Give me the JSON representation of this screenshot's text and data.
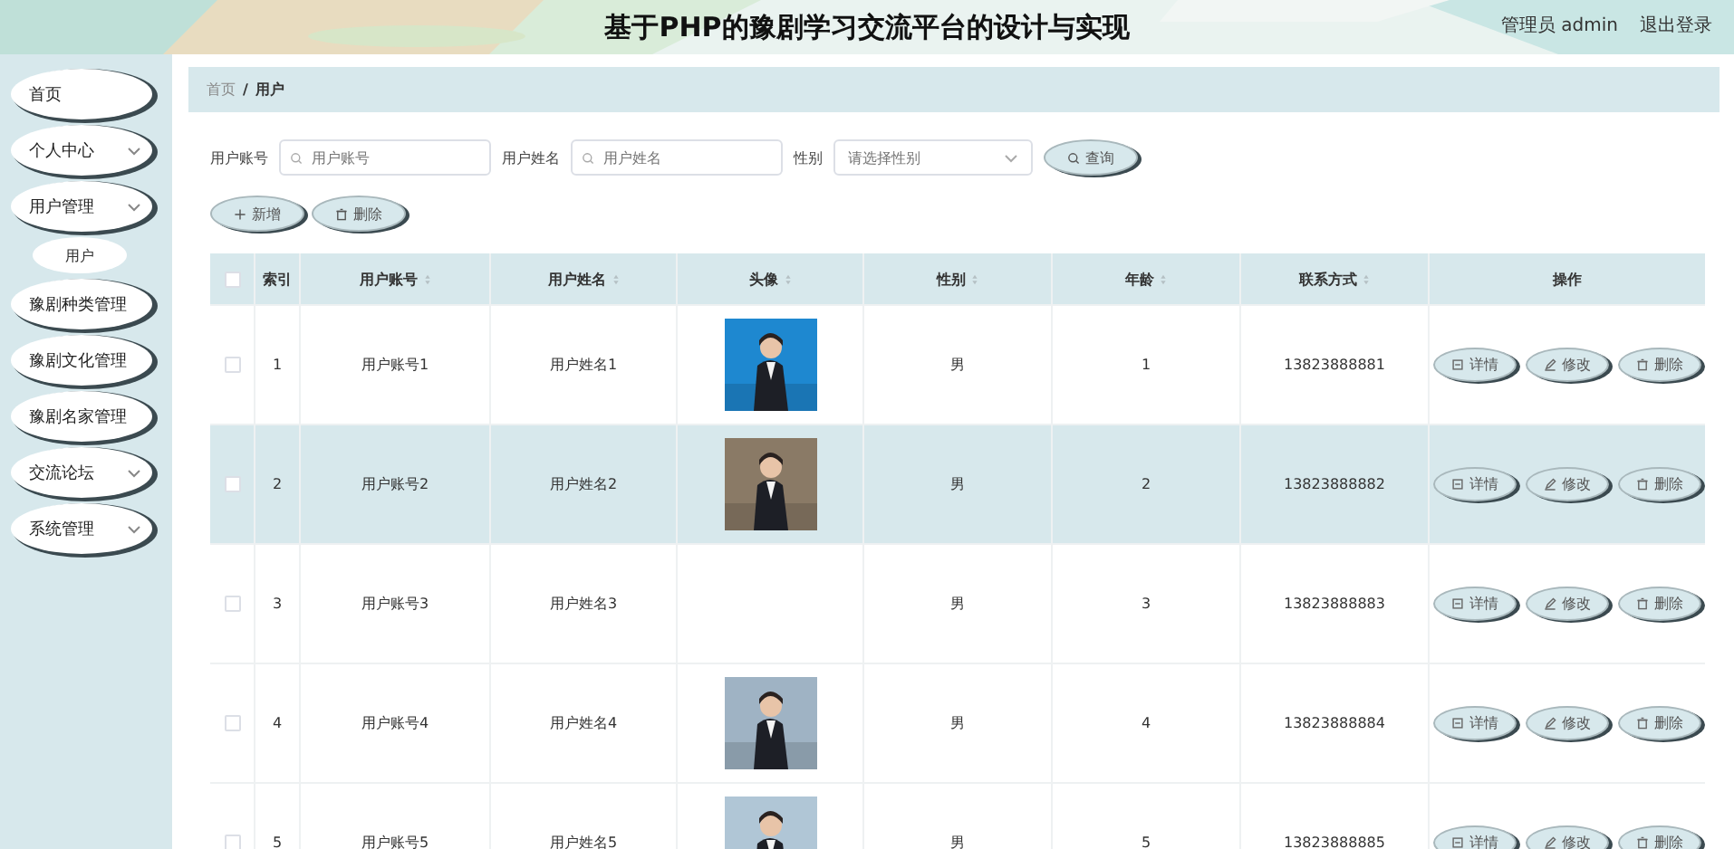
{
  "header": {
    "title": "基于PHP的豫剧学习交流平台的设计与实现",
    "user": "管理员 admin",
    "logout": "退出登录"
  },
  "sidebar": {
    "items": [
      {
        "label": "首页",
        "expandable": false
      },
      {
        "label": "个人中心",
        "expandable": true
      },
      {
        "label": "用户管理",
        "expandable": true,
        "children": [
          {
            "label": "用户",
            "selected": true
          }
        ]
      },
      {
        "label": "豫剧种类管理",
        "expandable": false
      },
      {
        "label": "豫剧文化管理",
        "expandable": false
      },
      {
        "label": "豫剧名家管理",
        "expandable": false
      },
      {
        "label": "交流论坛",
        "expandable": true
      },
      {
        "label": "系统管理",
        "expandable": true
      }
    ]
  },
  "breadcrumb": {
    "items": [
      "首页",
      "用户"
    ],
    "separator": "/"
  },
  "search": {
    "fields": [
      {
        "kind": "text",
        "label": "用户账号",
        "placeholder": "用户账号"
      },
      {
        "kind": "text",
        "label": "用户姓名",
        "placeholder": "用户姓名"
      },
      {
        "kind": "select",
        "label": "性别",
        "placeholder": "请选择性别"
      }
    ],
    "button": "查询"
  },
  "actions": [
    "新增",
    "删除"
  ],
  "table": {
    "select_all_checked": false,
    "columns": [
      {
        "label": "索引",
        "sortable": false
      },
      {
        "label": "用户账号",
        "sortable": true
      },
      {
        "label": "用户姓名",
        "sortable": true
      },
      {
        "label": "头像",
        "sortable": true
      },
      {
        "label": "性别",
        "sortable": true
      },
      {
        "label": "年龄",
        "sortable": true
      },
      {
        "label": "联系方式",
        "sortable": true
      },
      {
        "label": "操作",
        "sortable": false
      }
    ],
    "rows": [
      {
        "index": "1",
        "account": "用户账号1",
        "name": "用户姓名1",
        "photo": true,
        "gender": "男",
        "age": "1",
        "phone": "13823888881",
        "hovered": false,
        "checked": false,
        "actions": [
          {
            "kind": "detail",
            "label": "详情"
          },
          {
            "kind": "edit",
            "label": "修改"
          },
          {
            "kind": "delete",
            "label": "删除"
          }
        ]
      },
      {
        "index": "2",
        "account": "用户账号2",
        "name": "用户姓名2",
        "photo": true,
        "gender": "男",
        "age": "2",
        "phone": "13823888882",
        "hovered": true,
        "checked": false,
        "actions": [
          {
            "kind": "detail",
            "label": "详情"
          },
          {
            "kind": "edit",
            "label": "修改"
          },
          {
            "kind": "delete",
            "label": "删除"
          }
        ]
      },
      {
        "index": "3",
        "account": "用户账号3",
        "name": "用户姓名3",
        "photo": false,
        "gender": "男",
        "age": "3",
        "phone": "13823888883",
        "hovered": false,
        "checked": false,
        "actions": [
          {
            "kind": "detail",
            "label": "详情"
          },
          {
            "kind": "edit",
            "label": "修改"
          },
          {
            "kind": "delete",
            "label": "删除"
          }
        ]
      },
      {
        "index": "4",
        "account": "用户账号4",
        "name": "用户姓名4",
        "photo": true,
        "gender": "男",
        "age": "4",
        "phone": "13823888884",
        "hovered": false,
        "checked": false,
        "actions": [
          {
            "kind": "detail",
            "label": "详情"
          },
          {
            "kind": "edit",
            "label": "修改"
          },
          {
            "kind": "delete",
            "label": "删除"
          }
        ]
      },
      {
        "index": "5",
        "account": "用户账号5",
        "name": "用户姓名5",
        "photo": true,
        "gender": "男",
        "age": "5",
        "phone": "13823888885",
        "hovered": false,
        "checked": false,
        "actions": [
          {
            "kind": "detail",
            "label": "详情"
          },
          {
            "kind": "edit",
            "label": "修改"
          },
          {
            "kind": "delete",
            "label": "删除"
          }
        ]
      }
    ]
  }
}
